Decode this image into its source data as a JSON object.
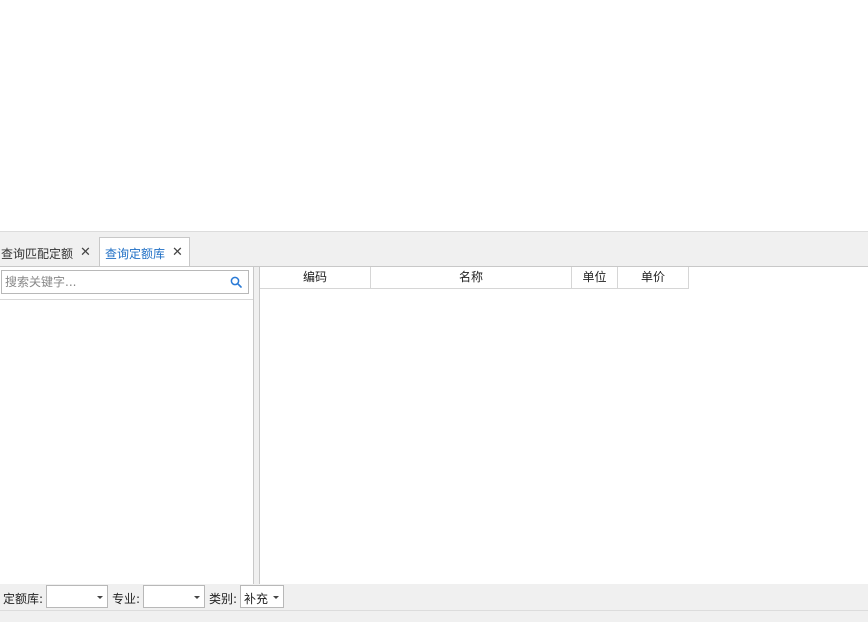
{
  "tabs": [
    {
      "label": "查询匹配定额",
      "active": false
    },
    {
      "label": "查询定额库",
      "active": true
    }
  ],
  "search": {
    "placeholder": "搜索关键字...",
    "value": ""
  },
  "table": {
    "columns": [
      "编码",
      "名称",
      "单位",
      "单价"
    ],
    "rows": []
  },
  "filters": {
    "quota_lib": {
      "label": "定额库:",
      "value": ""
    },
    "major": {
      "label": "专业:",
      "value": ""
    },
    "category": {
      "label": "类别:",
      "value": "补充"
    }
  },
  "colors": {
    "active_tab_text": "#1f6fc5",
    "panel_bg": "#f0f0f0",
    "border": "#c8c8c8",
    "search_icon": "#2a7ad6"
  },
  "icons": {
    "tab_close": "close-icon",
    "search": "search-icon",
    "dropdown": "chevron-down-icon"
  }
}
